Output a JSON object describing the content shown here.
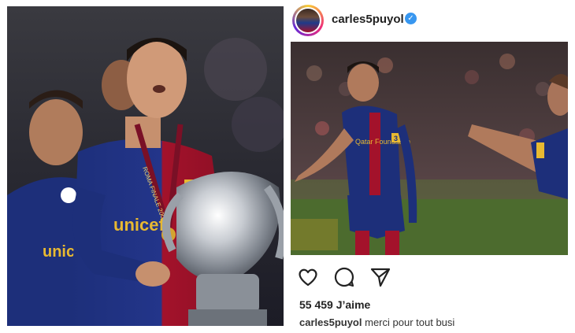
{
  "left_photo": {
    "kit_sponsor": "unicef",
    "medal_ribbon": "ROMA FINALE 2009",
    "teammate_sponsor": "unicef"
  },
  "post": {
    "username": "carles5puyol",
    "verified": true,
    "image": {
      "sponsor": "Qatar Foundation",
      "shirt_number": "3"
    },
    "actions": [
      "heart-icon",
      "comment-icon",
      "share-icon"
    ],
    "likes_count": "55 459",
    "likes_label": "J’aime",
    "caption_user": "carles5puyol",
    "caption_text": "merci pour tout busi"
  },
  "colors": {
    "barca_blue": "#1d2f7a",
    "barca_red": "#a3122b",
    "verified_blue": "#3897f0"
  }
}
